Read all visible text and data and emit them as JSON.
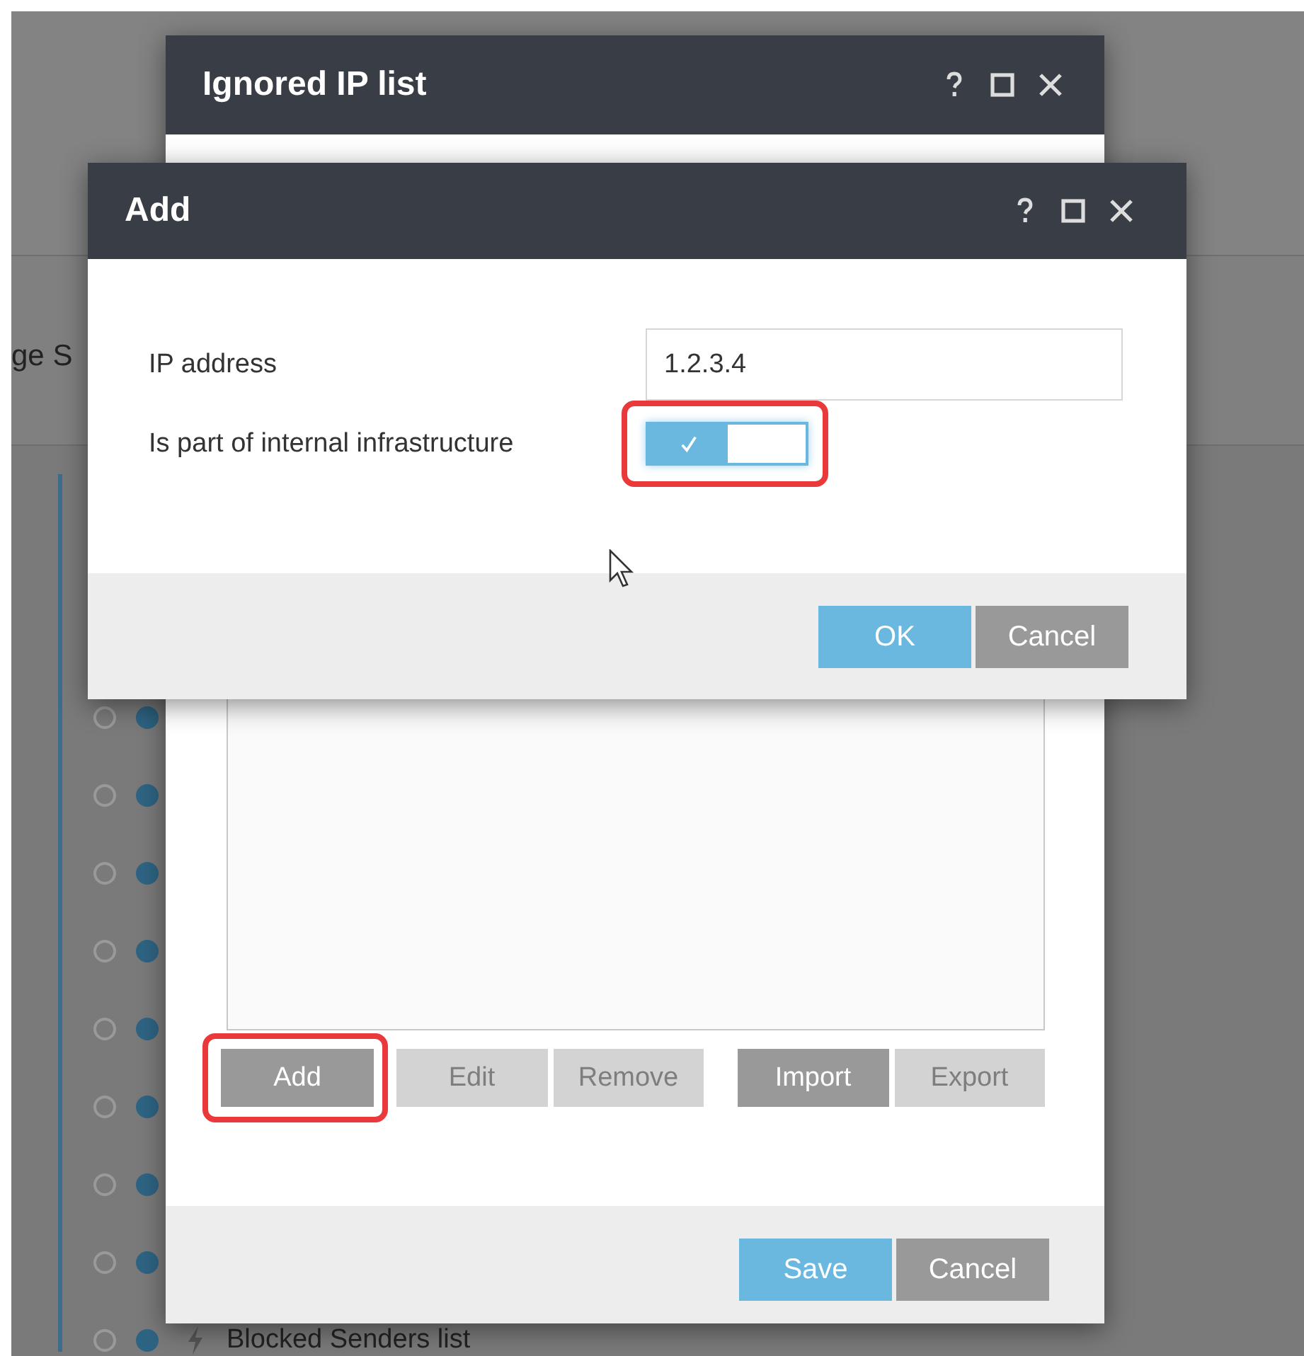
{
  "background": {
    "heading_fragment": "ge S",
    "rows": [
      {
        "selected": false
      },
      {
        "selected": false
      },
      {
        "selected": false
      },
      {
        "selected": false
      },
      {
        "selected": false
      },
      {
        "selected": false
      },
      {
        "selected": false
      },
      {
        "selected": false
      },
      {
        "selected": false,
        "label": "Blocked Senders list"
      }
    ]
  },
  "ignored_ip_window": {
    "title": "Ignored IP list",
    "list_buttons": [
      {
        "label": "Add",
        "disabled": false,
        "highlighted": true
      },
      {
        "label": "Edit",
        "disabled": true,
        "highlighted": false
      },
      {
        "label": "Remove",
        "disabled": true,
        "highlighted": false
      },
      {
        "label": "Import",
        "disabled": false,
        "highlighted": false
      },
      {
        "label": "Export",
        "disabled": true,
        "highlighted": false
      }
    ],
    "footer_buttons": [
      {
        "label": "Save",
        "kind": "primary"
      },
      {
        "label": "Cancel",
        "kind": "secondary"
      }
    ]
  },
  "add_window": {
    "title": "Add",
    "ip_address": {
      "label": "IP address",
      "value": "1.2.3.4"
    },
    "internal": {
      "label": "Is part of internal infrastructure",
      "on": true,
      "highlighted": true
    },
    "footer_buttons": [
      {
        "label": "OK",
        "kind": "primary"
      },
      {
        "label": "Cancel",
        "kind": "secondary"
      }
    ]
  }
}
